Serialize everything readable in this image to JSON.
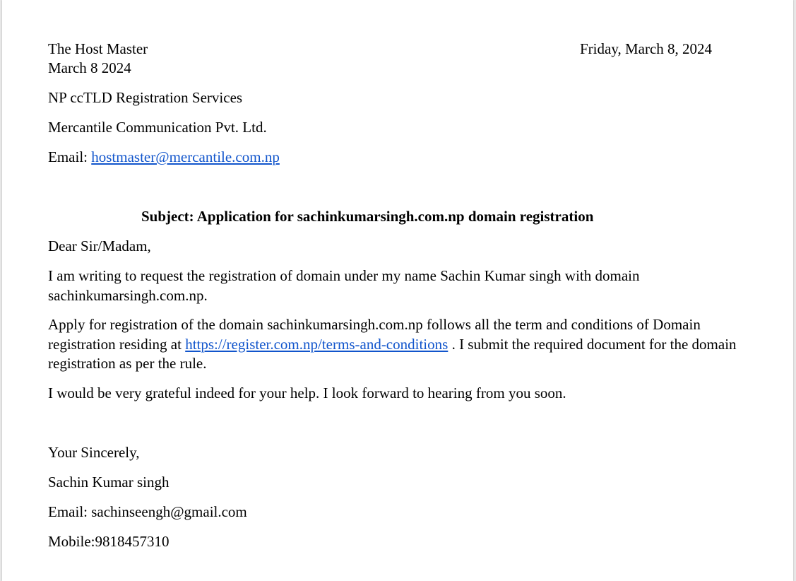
{
  "header": {
    "recipient_title": "The Host Master",
    "letter_date": "March 8 2024",
    "right_date": "Friday, March 8, 2024"
  },
  "recipient": {
    "organization": "NP ccTLD Registration Services",
    "company": "Mercantile Communication Pvt. Ltd.",
    "email_label": "Email: ",
    "email": "hostmaster@mercantile.com.np"
  },
  "subject": "Subject: Application for sachinkumarsingh.com.np domain registration",
  "salutation": "Dear Sir/Madam,",
  "body": {
    "para1": "I am writing to request the registration of domain under my name Sachin Kumar singh with domain sachinkumarsingh.com.np.",
    "para2_before_link": "Apply for registration of the domain sachinkumarsingh.com.np follows all the term and conditions of Domain registration residing at ",
    "para2_link": "https://register.com.np/terms-and-conditions",
    "para2_after_link": " . I submit the required document for the domain registration as per the rule.",
    "para3": "I would be very grateful indeed for your help. I look forward to hearing from you soon."
  },
  "closing": {
    "valediction": "Your Sincerely,",
    "name": "Sachin Kumar singh",
    "email": "Email: sachinseengh@gmail.com",
    "mobile": "Mobile:9818457310"
  },
  "colors": {
    "link": "#1155cc",
    "text": "#000000",
    "page": "#ffffff"
  }
}
